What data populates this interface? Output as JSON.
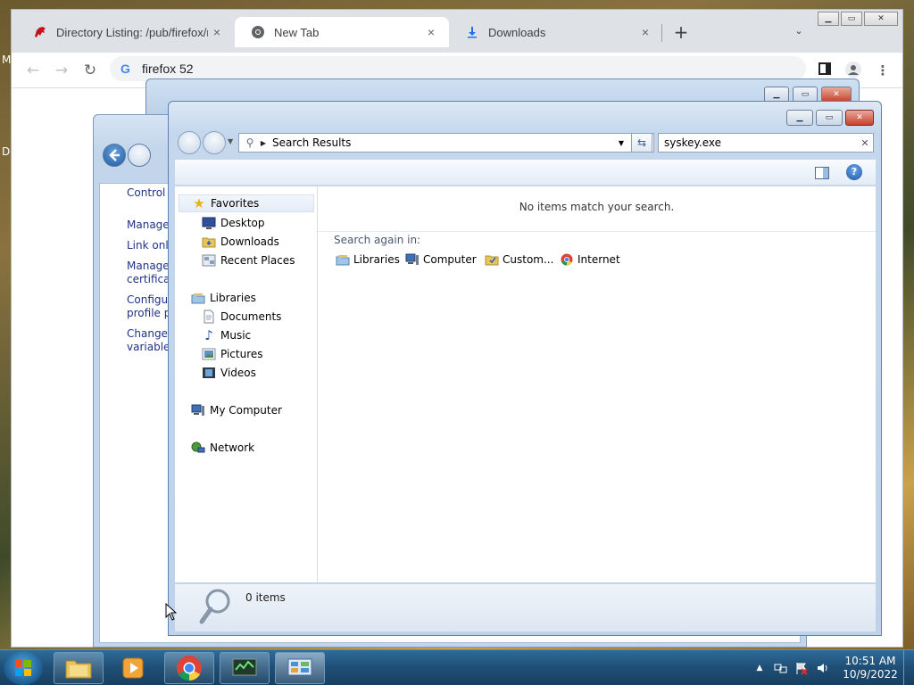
{
  "desktop": {
    "left_letters": [
      "M",
      "D"
    ]
  },
  "browser": {
    "tabs": [
      {
        "title": "Directory Listing: /pub/firefox/rel",
        "icon": "mozilla-dino-icon",
        "active": false
      },
      {
        "title": "New Tab",
        "icon": "chrome-icon",
        "active": true
      },
      {
        "title": "Downloads",
        "icon": "download-icon",
        "active": false
      }
    ],
    "tab_close": "×",
    "new_tab": "+",
    "tab_menu": "⌄",
    "address": "firefox 52",
    "colors": {
      "tabstrip": "#dee1e6",
      "active_tab": "#ffffff"
    }
  },
  "control_panel": {
    "partial_title": "Control P",
    "links": [
      "Manage y",
      "Link onli",
      "Manage y\ncertificat",
      "Configur\nprofile pr",
      "Change n\nvariables"
    ]
  },
  "explorer": {
    "breadcrumb": "Search Results",
    "search_value": "syskey.exe",
    "nav_pane": {
      "favorites": {
        "label": "Favorites",
        "items": [
          "Desktop",
          "Downloads",
          "Recent Places"
        ]
      },
      "libraries": {
        "label": "Libraries",
        "items": [
          "Documents",
          "Music",
          "Pictures",
          "Videos"
        ]
      },
      "computer": "My Computer",
      "network": "Network"
    },
    "no_items_message": "No items match your search.",
    "search_again_label": "Search again in:",
    "search_again_targets": [
      "Libraries",
      "Computer",
      "Custom...",
      "Internet"
    ],
    "item_count": "0 items"
  },
  "taskbar": {
    "buttons": [
      "explorer-folder",
      "media-player",
      "chrome",
      "system-monitor",
      "control-panel"
    ],
    "clock_time": "10:51 AM",
    "clock_date": "10/9/2022"
  }
}
